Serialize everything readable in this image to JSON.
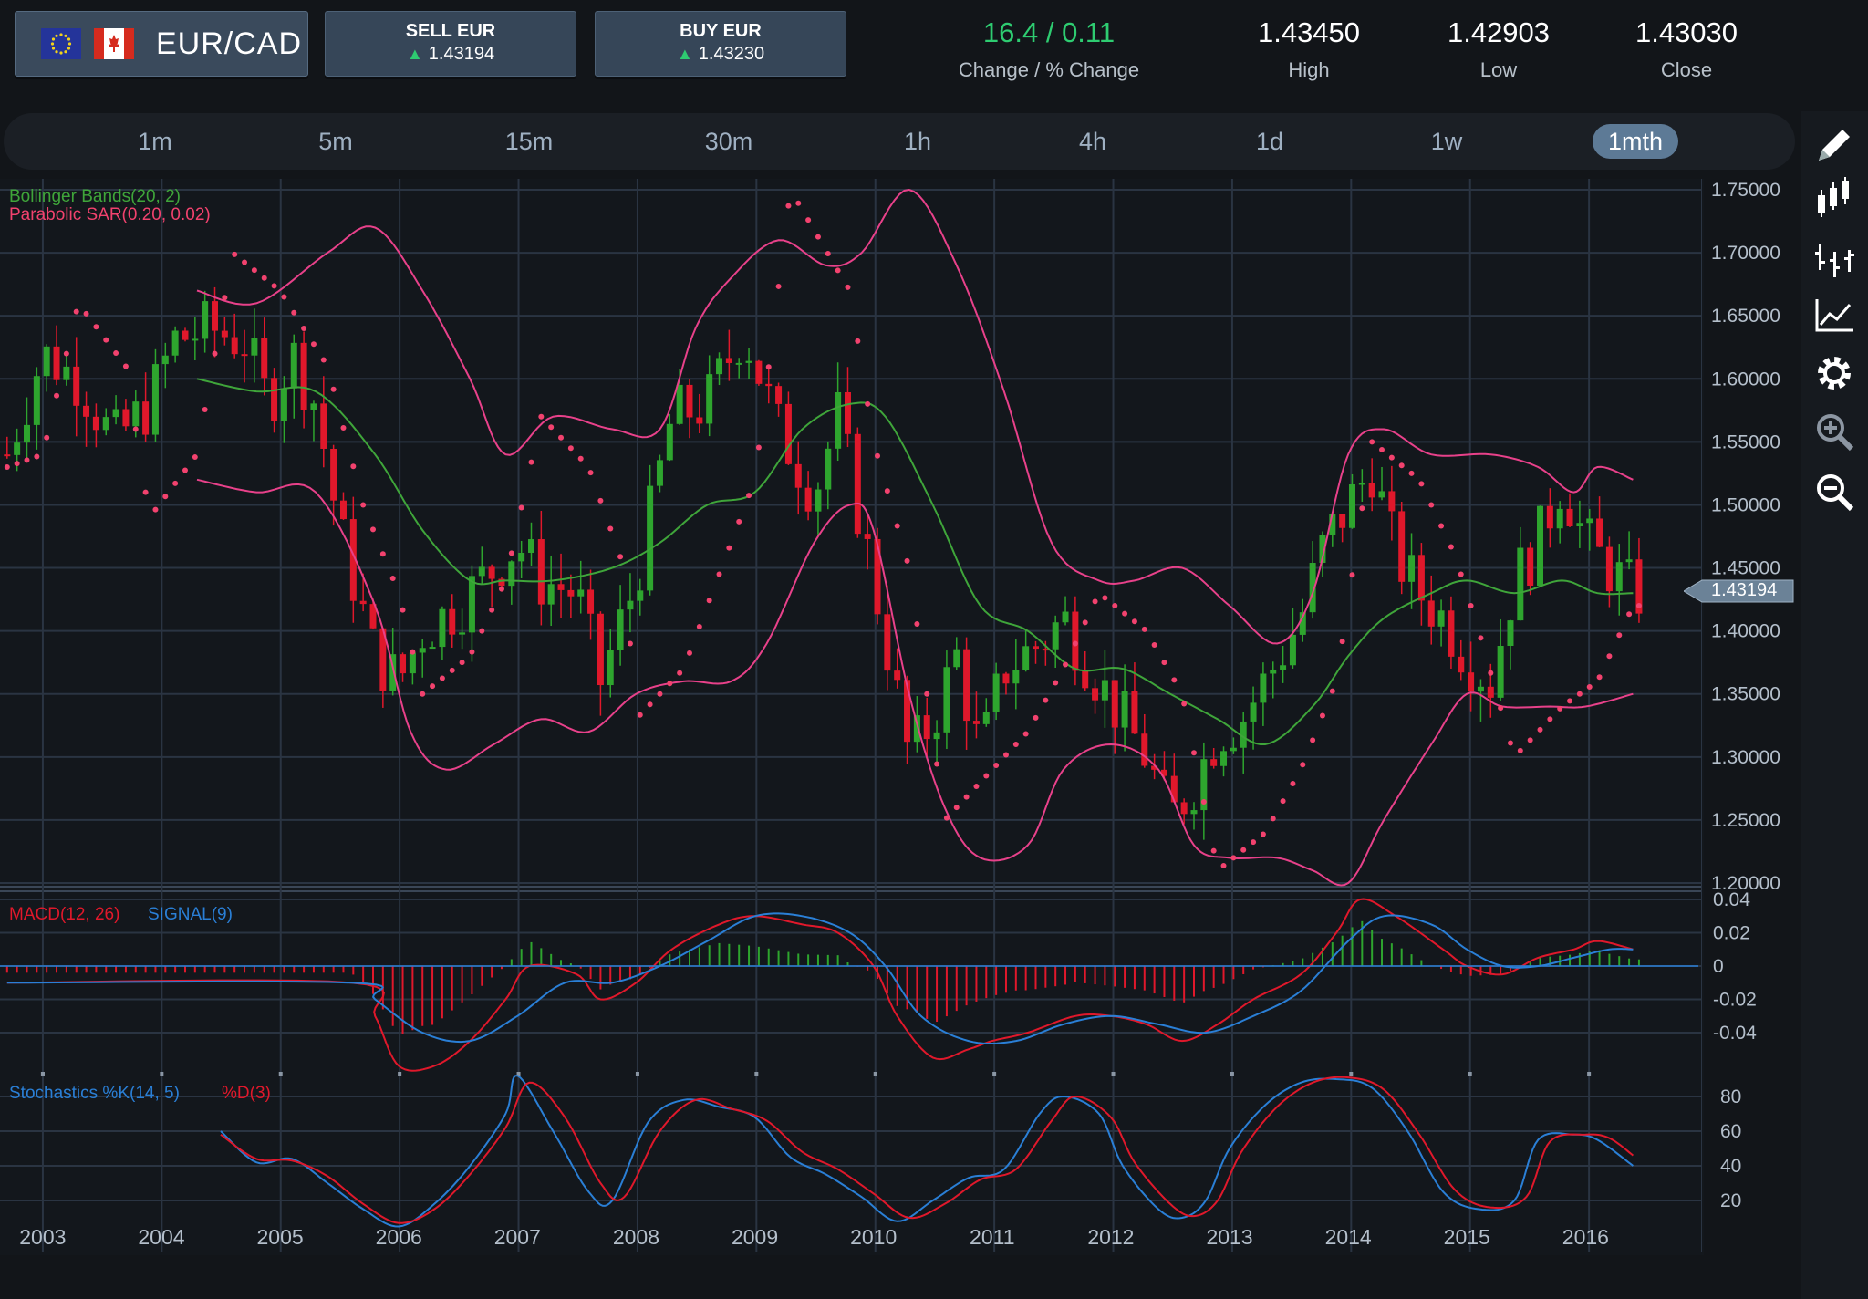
{
  "header": {
    "pair": "EUR/CAD",
    "sell_label": "SELL EUR",
    "sell_price": "1.43194",
    "buy_label": "BUY EUR",
    "buy_price": "1.43230",
    "change_value": "16.4 / 0.11",
    "change_label": "Change / % Change",
    "high_value": "1.43450",
    "high_label": "High",
    "low_value": "1.42903",
    "low_label": "Low",
    "close_value": "1.43030",
    "close_label": "Close",
    "colors": {
      "up": "#2ecc71",
      "change": "#2ecc71"
    }
  },
  "timeframes": [
    "1m",
    "5m",
    "15m",
    "30m",
    "1h",
    "4h",
    "1d",
    "1w",
    "1mth"
  ],
  "active_timeframe": "1mth",
  "tools": [
    "pencil-icon",
    "candlestick-icon",
    "bar-chart-icon",
    "line-chart-icon",
    "gear-icon",
    "zoom-in-icon",
    "zoom-out-icon"
  ],
  "main_chart": {
    "indicator_labels": [
      "Bollinger Bands(20, 2)",
      "Parabolic SAR(0.20, 0.02)"
    ],
    "y_ticks": [
      "1.75000",
      "1.70000",
      "1.65000",
      "1.60000",
      "1.55000",
      "1.50000",
      "1.45000",
      "1.40000",
      "1.35000",
      "1.30000",
      "1.25000",
      "1.20000"
    ],
    "current_price": "1.43194"
  },
  "macd_panel": {
    "label_macd": "MACD(12, 26)",
    "label_signal": "SIGNAL(9)",
    "y_ticks": [
      "0.04",
      "0.02",
      "0",
      "-0.02",
      "-0.04"
    ]
  },
  "stoch_panel": {
    "label_k": "Stochastics %K(14, 5)",
    "label_d": "%D(3)",
    "y_ticks": [
      "80",
      "60",
      "40",
      "20"
    ]
  },
  "x_ticks": [
    "2003",
    "2004",
    "2005",
    "2006",
    "2007",
    "2008",
    "2009",
    "2010",
    "2011",
    "2012",
    "2013",
    "2014",
    "2015",
    "2016"
  ],
  "chart_data": {
    "type": "candlestick",
    "title": "",
    "ylim": [
      1.2,
      1.75
    ],
    "x_range": [
      2002.64,
      2016.95
    ],
    "colors": {
      "up": "#2ea52e",
      "down": "#e0182b",
      "bb": "#e8418a",
      "bb_mid": "#3fa53a",
      "sar": "#f2426e",
      "macd": "#e0182b",
      "signal": "#2a7fd6",
      "k": "#2a7fd6",
      "d": "#e0182b"
    },
    "close_series": [
      [
        2002.7,
        1.54
      ],
      [
        2003.0,
        1.62
      ],
      [
        2003.3,
        1.6
      ],
      [
        2003.6,
        1.55
      ],
      [
        2003.9,
        1.58
      ],
      [
        2004.1,
        1.63
      ],
      [
        2004.4,
        1.64
      ],
      [
        2004.7,
        1.63
      ],
      [
        2004.9,
        1.58
      ],
      [
        2005.1,
        1.62
      ],
      [
        2005.3,
        1.58
      ],
      [
        2005.5,
        1.48
      ],
      [
        2005.8,
        1.38
      ],
      [
        2006.0,
        1.36
      ],
      [
        2006.2,
        1.4
      ],
      [
        2006.5,
        1.42
      ],
      [
        2006.8,
        1.45
      ],
      [
        2007.0,
        1.47
      ],
      [
        2007.2,
        1.44
      ],
      [
        2007.5,
        1.43
      ],
      [
        2007.7,
        1.36
      ],
      [
        2008.0,
        1.44
      ],
      [
        2008.3,
        1.57
      ],
      [
        2008.6,
        1.58
      ],
      [
        2008.9,
        1.64
      ],
      [
        2009.2,
        1.56
      ],
      [
        2009.5,
        1.51
      ],
      [
        2009.7,
        1.57
      ],
      [
        2010.0,
        1.44
      ],
      [
        2010.3,
        1.3
      ],
      [
        2010.5,
        1.33
      ],
      [
        2010.7,
        1.38
      ],
      [
        2010.9,
        1.3
      ],
      [
        2011.1,
        1.37
      ],
      [
        2011.4,
        1.39
      ],
      [
        2011.6,
        1.41
      ],
      [
        2011.9,
        1.36
      ],
      [
        2012.1,
        1.33
      ],
      [
        2012.3,
        1.3
      ],
      [
        2012.5,
        1.25
      ],
      [
        2012.7,
        1.28
      ],
      [
        2012.9,
        1.32
      ],
      [
        2013.1,
        1.33
      ],
      [
        2013.3,
        1.36
      ],
      [
        2013.6,
        1.41
      ],
      [
        2013.8,
        1.47
      ],
      [
        2014.0,
        1.5
      ],
      [
        2014.2,
        1.53
      ],
      [
        2014.4,
        1.46
      ],
      [
        2014.6,
        1.43
      ],
      [
        2014.8,
        1.41
      ],
      [
        2015.0,
        1.38
      ],
      [
        2015.2,
        1.36
      ],
      [
        2015.4,
        1.44
      ],
      [
        2015.6,
        1.47
      ],
      [
        2015.8,
        1.52
      ],
      [
        2016.0,
        1.47
      ],
      [
        2016.2,
        1.45
      ],
      [
        2016.4,
        1.43
      ]
    ],
    "bb_upper": [
      [
        2004.3,
        1.67
      ],
      [
        2004.8,
        1.66
      ],
      [
        2005.4,
        1.7
      ],
      [
        2005.8,
        1.72
      ],
      [
        2006.2,
        1.67
      ],
      [
        2006.6,
        1.6
      ],
      [
        2006.9,
        1.54
      ],
      [
        2007.3,
        1.57
      ],
      [
        2007.8,
        1.56
      ],
      [
        2008.2,
        1.56
      ],
      [
        2008.5,
        1.64
      ],
      [
        2008.8,
        1.68
      ],
      [
        2009.2,
        1.71
      ],
      [
        2009.6,
        1.69
      ],
      [
        2009.9,
        1.7
      ],
      [
        2010.3,
        1.75
      ],
      [
        2010.7,
        1.69
      ],
      [
        2011.1,
        1.59
      ],
      [
        2011.5,
        1.47
      ],
      [
        2011.9,
        1.44
      ],
      [
        2012.2,
        1.44
      ],
      [
        2012.6,
        1.45
      ],
      [
        2013.0,
        1.42
      ],
      [
        2013.4,
        1.39
      ],
      [
        2013.7,
        1.43
      ],
      [
        2014.0,
        1.54
      ],
      [
        2014.3,
        1.56
      ],
      [
        2014.7,
        1.54
      ],
      [
        2015.2,
        1.54
      ],
      [
        2015.6,
        1.53
      ],
      [
        2015.9,
        1.51
      ],
      [
        2016.1,
        1.53
      ],
      [
        2016.4,
        1.52
      ]
    ],
    "bb_lower": [
      [
        2004.3,
        1.52
      ],
      [
        2004.8,
        1.51
      ],
      [
        2005.3,
        1.51
      ],
      [
        2005.8,
        1.42
      ],
      [
        2006.1,
        1.32
      ],
      [
        2006.4,
        1.29
      ],
      [
        2006.8,
        1.31
      ],
      [
        2007.2,
        1.33
      ],
      [
        2007.6,
        1.32
      ],
      [
        2008.0,
        1.35
      ],
      [
        2008.4,
        1.36
      ],
      [
        2008.8,
        1.36
      ],
      [
        2009.1,
        1.39
      ],
      [
        2009.5,
        1.47
      ],
      [
        2009.8,
        1.5
      ],
      [
        2010.0,
        1.48
      ],
      [
        2010.3,
        1.35
      ],
      [
        2010.6,
        1.26
      ],
      [
        2010.9,
        1.22
      ],
      [
        2011.3,
        1.23
      ],
      [
        2011.6,
        1.29
      ],
      [
        2012.0,
        1.31
      ],
      [
        2012.4,
        1.29
      ],
      [
        2012.7,
        1.23
      ],
      [
        2013.0,
        1.22
      ],
      [
        2013.4,
        1.22
      ],
      [
        2013.7,
        1.21
      ],
      [
        2014.0,
        1.2
      ],
      [
        2014.3,
        1.25
      ],
      [
        2014.7,
        1.31
      ],
      [
        2015.0,
        1.35
      ],
      [
        2015.3,
        1.34
      ],
      [
        2015.7,
        1.34
      ],
      [
        2016.0,
        1.34
      ],
      [
        2016.4,
        1.35
      ]
    ],
    "bb_mid": [
      [
        2004.3,
        1.6
      ],
      [
        2004.8,
        1.59
      ],
      [
        2005.3,
        1.59
      ],
      [
        2005.8,
        1.54
      ],
      [
        2006.2,
        1.48
      ],
      [
        2006.6,
        1.44
      ],
      [
        2006.9,
        1.44
      ],
      [
        2007.3,
        1.44
      ],
      [
        2007.8,
        1.45
      ],
      [
        2008.2,
        1.47
      ],
      [
        2008.6,
        1.5
      ],
      [
        2009.0,
        1.51
      ],
      [
        2009.4,
        1.56
      ],
      [
        2009.8,
        1.58
      ],
      [
        2010.1,
        1.57
      ],
      [
        2010.5,
        1.5
      ],
      [
        2010.9,
        1.42
      ],
      [
        2011.3,
        1.4
      ],
      [
        2011.7,
        1.37
      ],
      [
        2012.1,
        1.37
      ],
      [
        2012.5,
        1.35
      ],
      [
        2012.9,
        1.33
      ],
      [
        2013.3,
        1.31
      ],
      [
        2013.7,
        1.34
      ],
      [
        2014.0,
        1.38
      ],
      [
        2014.3,
        1.41
      ],
      [
        2014.7,
        1.43
      ],
      [
        2015.0,
        1.44
      ],
      [
        2015.4,
        1.43
      ],
      [
        2015.8,
        1.44
      ],
      [
        2016.1,
        1.43
      ],
      [
        2016.4,
        1.43
      ]
    ],
    "sar": [
      [
        2002.7,
        1.53
      ],
      [
        2003.0,
        1.54
      ],
      [
        2003.3,
        1.66
      ],
      [
        2003.7,
        1.61
      ],
      [
        2003.9,
        1.49
      ],
      [
        2004.3,
        1.54
      ],
      [
        2004.6,
        1.7
      ],
      [
        2005.0,
        1.67
      ],
      [
        2005.4,
        1.61
      ],
      [
        2005.7,
        1.5
      ],
      [
        2006.0,
        1.43
      ],
      [
        2006.2,
        1.35
      ],
      [
        2006.6,
        1.38
      ],
      [
        2006.9,
        1.44
      ],
      [
        2007.2,
        1.57
      ],
      [
        2007.6,
        1.53
      ],
      [
        2007.9,
        1.45
      ],
      [
        2008.0,
        1.33
      ],
      [
        2008.4,
        1.37
      ],
      [
        2008.8,
        1.47
      ],
      [
        2009.0,
        1.52
      ],
      [
        2009.3,
        1.75
      ],
      [
        2009.8,
        1.67
      ],
      [
        2010.0,
        1.55
      ],
      [
        2010.3,
        1.45
      ],
      [
        2010.6,
        1.25
      ],
      [
        2010.9,
        1.28
      ],
      [
        2011.3,
        1.32
      ],
      [
        2011.6,
        1.37
      ],
      [
        2011.9,
        1.43
      ],
      [
        2012.3,
        1.4
      ],
      [
        2012.6,
        1.35
      ],
      [
        2012.9,
        1.21
      ],
      [
        2013.3,
        1.24
      ],
      [
        2013.6,
        1.29
      ],
      [
        2013.9,
        1.36
      ],
      [
        2014.2,
        1.55
      ],
      [
        2014.6,
        1.52
      ],
      [
        2014.9,
        1.46
      ],
      [
        2015.1,
        1.4
      ],
      [
        2015.4,
        1.3
      ],
      [
        2015.8,
        1.34
      ],
      [
        2016.1,
        1.36
      ],
      [
        2016.4,
        1.42
      ]
    ],
    "macd": [
      [
        2002.7,
        -0.01
      ],
      [
        2005.6,
        -0.01
      ],
      [
        2005.8,
        -0.03
      ],
      [
        2006.0,
        -0.06
      ],
      [
        2006.3,
        -0.06
      ],
      [
        2006.6,
        -0.045
      ],
      [
        2006.9,
        -0.02
      ],
      [
        2007.1,
        0.0
      ],
      [
        2007.5,
        -0.005
      ],
      [
        2007.7,
        -0.02
      ],
      [
        2008.0,
        -0.01
      ],
      [
        2008.3,
        0.01
      ],
      [
        2008.7,
        0.025
      ],
      [
        2009.0,
        0.03
      ],
      [
        2009.4,
        0.025
      ],
      [
        2009.7,
        0.02
      ],
      [
        2010.0,
        0.0
      ],
      [
        2010.2,
        -0.03
      ],
      [
        2010.5,
        -0.055
      ],
      [
        2010.8,
        -0.05
      ],
      [
        2011.0,
        -0.045
      ],
      [
        2011.3,
        -0.04
      ],
      [
        2011.7,
        -0.03
      ],
      [
        2012.0,
        -0.03
      ],
      [
        2012.3,
        -0.035
      ],
      [
        2012.6,
        -0.045
      ],
      [
        2012.9,
        -0.035
      ],
      [
        2013.2,
        -0.02
      ],
      [
        2013.6,
        -0.005
      ],
      [
        2013.9,
        0.02
      ],
      [
        2014.1,
        0.04
      ],
      [
        2014.4,
        0.03
      ],
      [
        2014.8,
        0.01
      ],
      [
        2015.0,
        0.0
      ],
      [
        2015.3,
        -0.005
      ],
      [
        2015.6,
        0.005
      ],
      [
        2015.9,
        0.01
      ],
      [
        2016.1,
        0.015
      ],
      [
        2016.4,
        0.01
      ]
    ],
    "signal": [
      [
        2002.7,
        -0.01
      ],
      [
        2005.6,
        -0.01
      ],
      [
        2005.8,
        -0.02
      ],
      [
        2006.2,
        -0.04
      ],
      [
        2006.6,
        -0.045
      ],
      [
        2007.0,
        -0.03
      ],
      [
        2007.4,
        -0.01
      ],
      [
        2007.8,
        -0.01
      ],
      [
        2008.2,
        0.0
      ],
      [
        2008.6,
        0.015
      ],
      [
        2009.0,
        0.03
      ],
      [
        2009.4,
        0.03
      ],
      [
        2009.8,
        0.02
      ],
      [
        2010.1,
        0.0
      ],
      [
        2010.4,
        -0.03
      ],
      [
        2010.8,
        -0.045
      ],
      [
        2011.2,
        -0.045
      ],
      [
        2011.6,
        -0.035
      ],
      [
        2012.0,
        -0.03
      ],
      [
        2012.4,
        -0.035
      ],
      [
        2012.8,
        -0.04
      ],
      [
        2013.2,
        -0.03
      ],
      [
        2013.6,
        -0.015
      ],
      [
        2014.0,
        0.015
      ],
      [
        2014.3,
        0.03
      ],
      [
        2014.7,
        0.025
      ],
      [
        2015.0,
        0.01
      ],
      [
        2015.3,
        0.0
      ],
      [
        2015.6,
        0.0
      ],
      [
        2015.9,
        0.005
      ],
      [
        2016.2,
        0.01
      ],
      [
        2016.4,
        0.01
      ]
    ],
    "stoch_k": [
      [
        2004.5,
        60
      ],
      [
        2004.8,
        42
      ],
      [
        2005.1,
        44
      ],
      [
        2005.4,
        30
      ],
      [
        2005.7,
        15
      ],
      [
        2006.0,
        5
      ],
      [
        2006.3,
        18
      ],
      [
        2006.6,
        40
      ],
      [
        2006.9,
        70
      ],
      [
        2007.0,
        92
      ],
      [
        2007.3,
        60
      ],
      [
        2007.6,
        25
      ],
      [
        2007.8,
        20
      ],
      [
        2008.1,
        65
      ],
      [
        2008.4,
        78
      ],
      [
        2008.7,
        74
      ],
      [
        2009.0,
        68
      ],
      [
        2009.3,
        45
      ],
      [
        2009.6,
        35
      ],
      [
        2009.9,
        22
      ],
      [
        2010.2,
        8
      ],
      [
        2010.5,
        20
      ],
      [
        2010.8,
        33
      ],
      [
        2011.1,
        38
      ],
      [
        2011.4,
        70
      ],
      [
        2011.6,
        80
      ],
      [
        2011.9,
        70
      ],
      [
        2012.1,
        40
      ],
      [
        2012.4,
        15
      ],
      [
        2012.6,
        10
      ],
      [
        2012.8,
        20
      ],
      [
        2013.0,
        50
      ],
      [
        2013.3,
        75
      ],
      [
        2013.6,
        88
      ],
      [
        2013.9,
        90
      ],
      [
        2014.2,
        85
      ],
      [
        2014.5,
        60
      ],
      [
        2014.8,
        25
      ],
      [
        2015.1,
        15
      ],
      [
        2015.4,
        20
      ],
      [
        2015.6,
        55
      ],
      [
        2015.9,
        58
      ],
      [
        2016.1,
        55
      ],
      [
        2016.4,
        40
      ]
    ],
    "stoch_d": [
      [
        2004.5,
        58
      ],
      [
        2004.8,
        44
      ],
      [
        2005.1,
        43
      ],
      [
        2005.4,
        34
      ],
      [
        2005.7,
        18
      ],
      [
        2006.0,
        7
      ],
      [
        2006.3,
        15
      ],
      [
        2006.6,
        35
      ],
      [
        2006.9,
        62
      ],
      [
        2007.1,
        88
      ],
      [
        2007.4,
        68
      ],
      [
        2007.7,
        30
      ],
      [
        2007.9,
        22
      ],
      [
        2008.2,
        60
      ],
      [
        2008.5,
        78
      ],
      [
        2008.8,
        73
      ],
      [
        2009.1,
        66
      ],
      [
        2009.4,
        48
      ],
      [
        2009.7,
        38
      ],
      [
        2010.0,
        24
      ],
      [
        2010.3,
        10
      ],
      [
        2010.6,
        18
      ],
      [
        2010.9,
        32
      ],
      [
        2011.2,
        38
      ],
      [
        2011.5,
        66
      ],
      [
        2011.7,
        80
      ],
      [
        2012.0,
        68
      ],
      [
        2012.2,
        42
      ],
      [
        2012.5,
        18
      ],
      [
        2012.7,
        11
      ],
      [
        2012.9,
        20
      ],
      [
        2013.1,
        48
      ],
      [
        2013.4,
        74
      ],
      [
        2013.7,
        88
      ],
      [
        2014.0,
        91
      ],
      [
        2014.3,
        84
      ],
      [
        2014.6,
        58
      ],
      [
        2014.9,
        26
      ],
      [
        2015.2,
        16
      ],
      [
        2015.5,
        22
      ],
      [
        2015.7,
        54
      ],
      [
        2016.0,
        58
      ],
      [
        2016.2,
        56
      ],
      [
        2016.4,
        46
      ]
    ]
  }
}
